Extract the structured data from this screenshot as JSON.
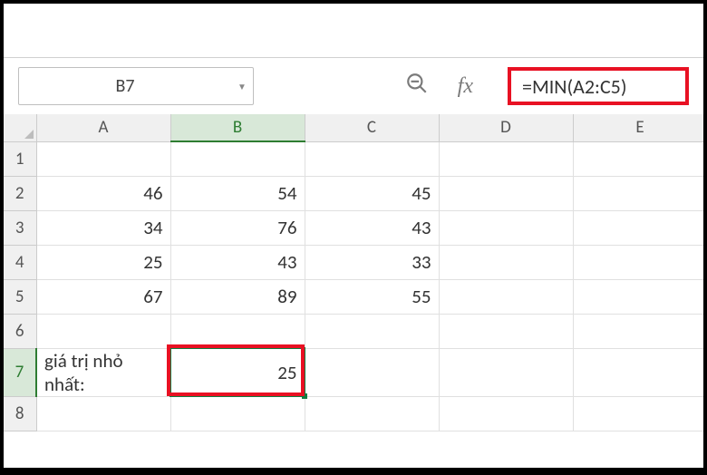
{
  "namebox": {
    "value": "B7",
    "dropdown_icon": "▼"
  },
  "formula_bar": {
    "formula": "=MIN(A2:C5)"
  },
  "icons": {
    "zoom": "⊖",
    "fx": "fx"
  },
  "columns": [
    "A",
    "B",
    "C",
    "D",
    "E"
  ],
  "rows": [
    "1",
    "2",
    "3",
    "4",
    "5",
    "6",
    "7",
    "8"
  ],
  "active_col": "B",
  "active_row": "7",
  "cells": {
    "A2": "46",
    "B2": "54",
    "C2": "45",
    "A3": "34",
    "B3": "76",
    "C3": "43",
    "A4": "25",
    "B4": "43",
    "C4": "33",
    "A5": "67",
    "B5": "89",
    "C5": "55",
    "A7": "giá trị nhỏ nhất:",
    "B7": "25"
  },
  "chart_data": {
    "type": "table",
    "title": "Spreadsheet MIN function example",
    "columns": [
      "A",
      "B",
      "C"
    ],
    "data_rows": [
      [
        46,
        54,
        45
      ],
      [
        34,
        76,
        43
      ],
      [
        25,
        43,
        33
      ],
      [
        67,
        89,
        55
      ]
    ],
    "label_row": {
      "A": "giá trị nhỏ nhất:",
      "B": 25
    },
    "formula": "=MIN(A2:C5)",
    "result": 25
  }
}
